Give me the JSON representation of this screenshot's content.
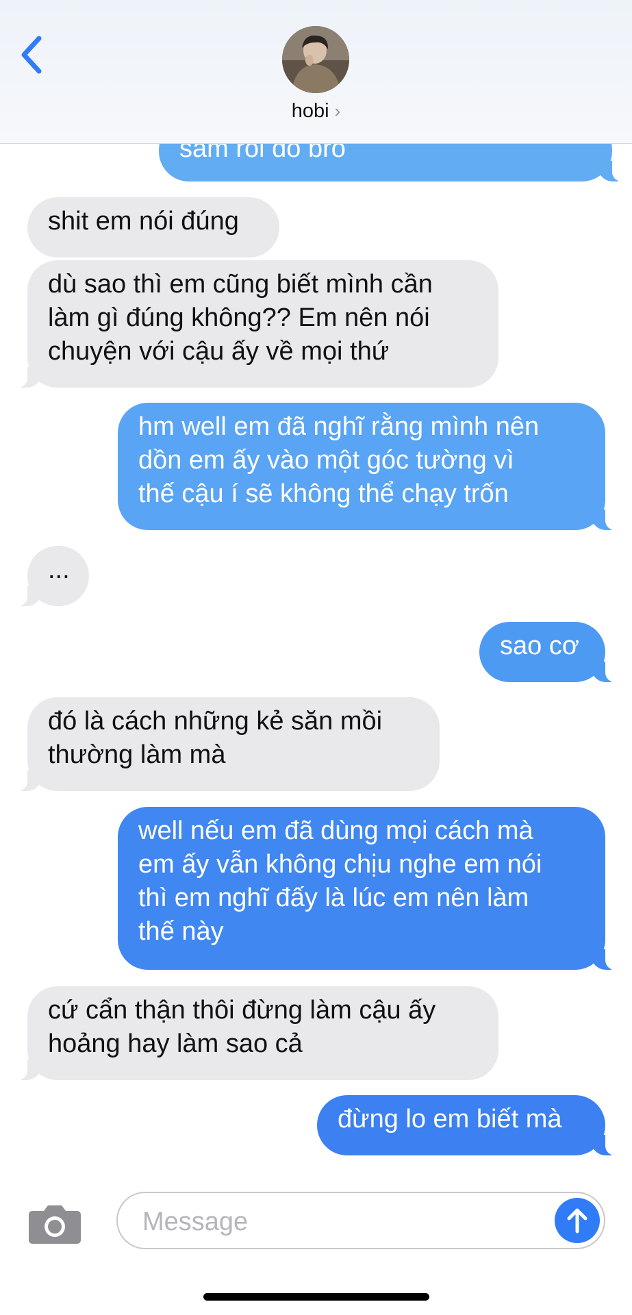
{
  "header": {
    "contact_name": "hobi",
    "chevron": "›",
    "icons": {
      "back": "chevron-left-icon",
      "avatar": "avatar"
    }
  },
  "messages": [
    {
      "side": "out",
      "lines": [
        "sắm rồi đó bro"
      ]
    },
    {
      "side": "in",
      "lines": [
        "shit em nói đúng"
      ]
    },
    {
      "side": "in",
      "lines": [
        "dù sao thì em cũng biết mình cần",
        "làm gì đúng không?? Em nên nói",
        "chuyện với cậu ấy về mọi thứ"
      ]
    },
    {
      "side": "out",
      "lines": [
        " hm well em đã nghĩ rằng mình nên",
        "dồn em ấy vào một góc tường vì",
        "thế cậu í sẽ không thể chạy trốn"
      ]
    },
    {
      "side": "in",
      "lines": [
        "..."
      ]
    },
    {
      "side": "out",
      "lines": [
        "sao cơ"
      ]
    },
    {
      "side": "in",
      "lines": [
        "đó là cách những kẻ săn mồi",
        "thường làm mà"
      ]
    },
    {
      "side": "out",
      "lines": [
        "well nếu em đã dùng mọi cách mà",
        "em ấy vẫn không chịu nghe em nói",
        "thì em nghĩ đấy là lúc em nên làm",
        "thế này"
      ]
    },
    {
      "side": "in",
      "lines": [
        "cứ cẩn thận thôi đừng làm cậu ấy",
        "hoảng hay làm sao cả"
      ]
    },
    {
      "side": "out",
      "lines": [
        "đừng lo em biết mà"
      ]
    }
  ],
  "composer": {
    "placeholder": "Message",
    "value": "",
    "icons": {
      "camera": "camera-icon",
      "send": "send-arrow-icon"
    }
  },
  "colors": {
    "incoming_bubble": "#e9e9eb",
    "outgoing_bubble": "#4a9af2",
    "accent": "#2f7cf6"
  }
}
